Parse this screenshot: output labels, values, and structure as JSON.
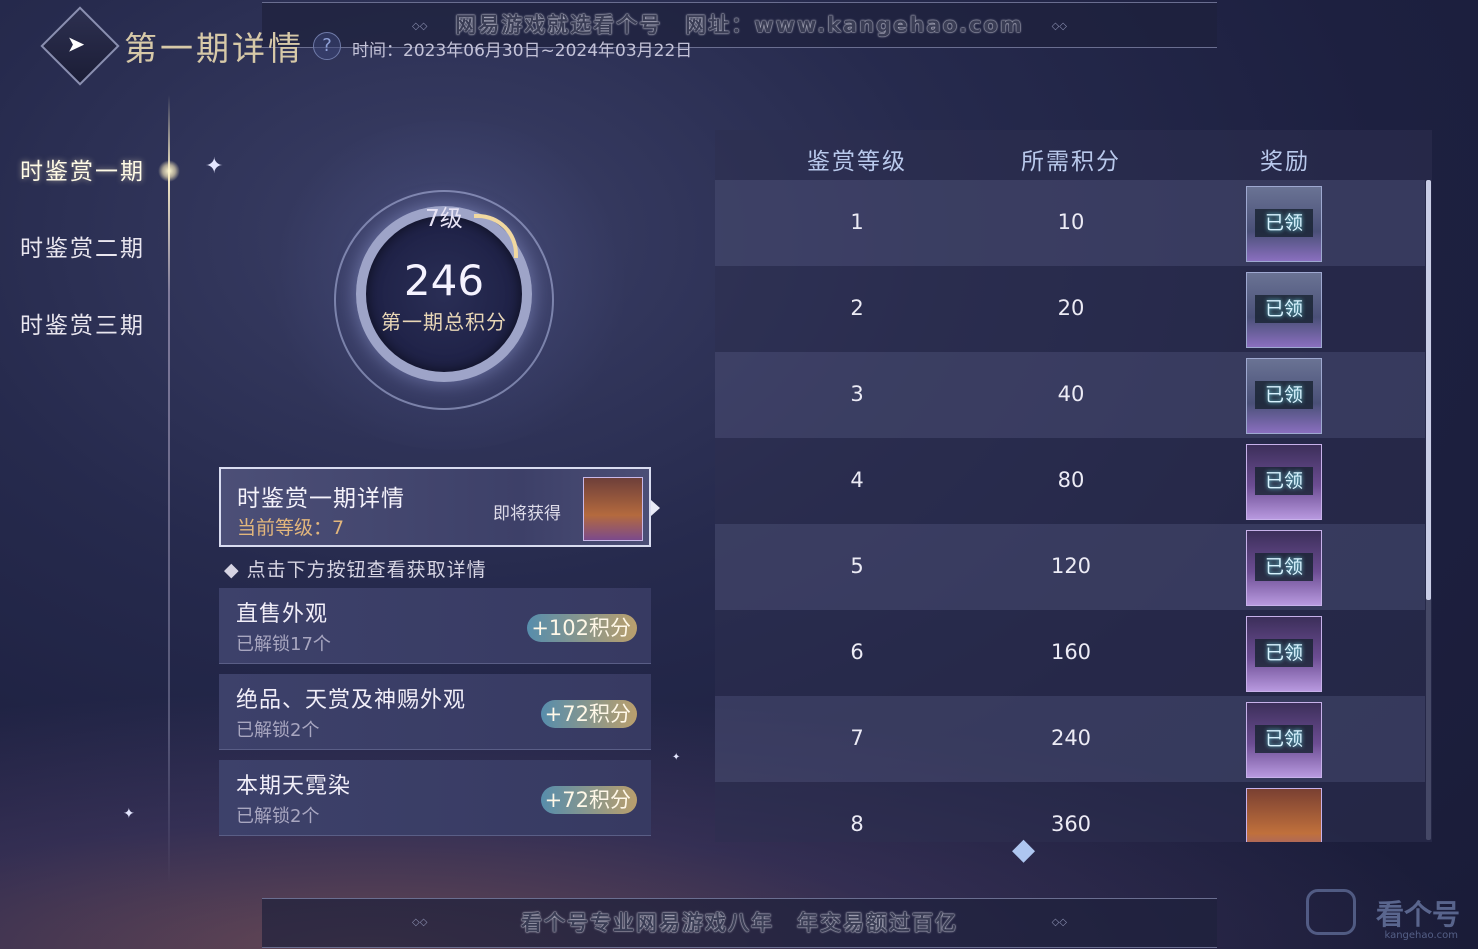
{
  "header": {
    "title": "第一期详情",
    "time_text": "时间：2023年06月30日~2024年03月22日",
    "banner_top": "网易游戏就选看个号　网址：www.kangehao.com",
    "banner_bottom": "看个号专业网易游戏八年　年交易额过百亿"
  },
  "nav": {
    "items": [
      {
        "label": "时鉴赏一期",
        "active": true
      },
      {
        "label": "时鉴赏二期",
        "active": false
      },
      {
        "label": "时鉴赏三期",
        "active": false
      }
    ]
  },
  "ring": {
    "level": "7级",
    "score": "246",
    "label": "第一期总积分"
  },
  "detail": {
    "title": "时鉴赏一期详情",
    "current_level": "当前等级：7",
    "soon_label": "即将获得"
  },
  "hint": "◆ 点击下方按钮查看获取详情",
  "sources": [
    {
      "title": "直售外观",
      "sub": "已解锁17个",
      "points": "+102积分"
    },
    {
      "title": "绝品、天赏及神赐外观",
      "sub": "已解锁2个",
      "points": "+72积分"
    },
    {
      "title": "本期天霓染",
      "sub": "已解锁2个",
      "points": "+72积分"
    }
  ],
  "table": {
    "headers": {
      "level": "鉴赏等级",
      "points": "所需积分",
      "reward": "奖励"
    },
    "rows": [
      {
        "level": "1",
        "points": "10",
        "status": "已领",
        "style": "blue"
      },
      {
        "level": "2",
        "points": "20",
        "status": "已领",
        "style": "blue"
      },
      {
        "level": "3",
        "points": "40",
        "status": "已领",
        "style": "blue"
      },
      {
        "level": "4",
        "points": "80",
        "status": "已领",
        "style": "purple"
      },
      {
        "level": "5",
        "points": "120",
        "status": "已领",
        "style": "purple"
      },
      {
        "level": "6",
        "points": "160",
        "status": "已领",
        "style": "purple"
      },
      {
        "level": "7",
        "points": "240",
        "status": "已领",
        "style": "purple"
      },
      {
        "level": "8",
        "points": "360",
        "status": "",
        "style": "fire"
      }
    ]
  },
  "watermark": {
    "text": "看个号",
    "sub": "kangehao.com"
  }
}
